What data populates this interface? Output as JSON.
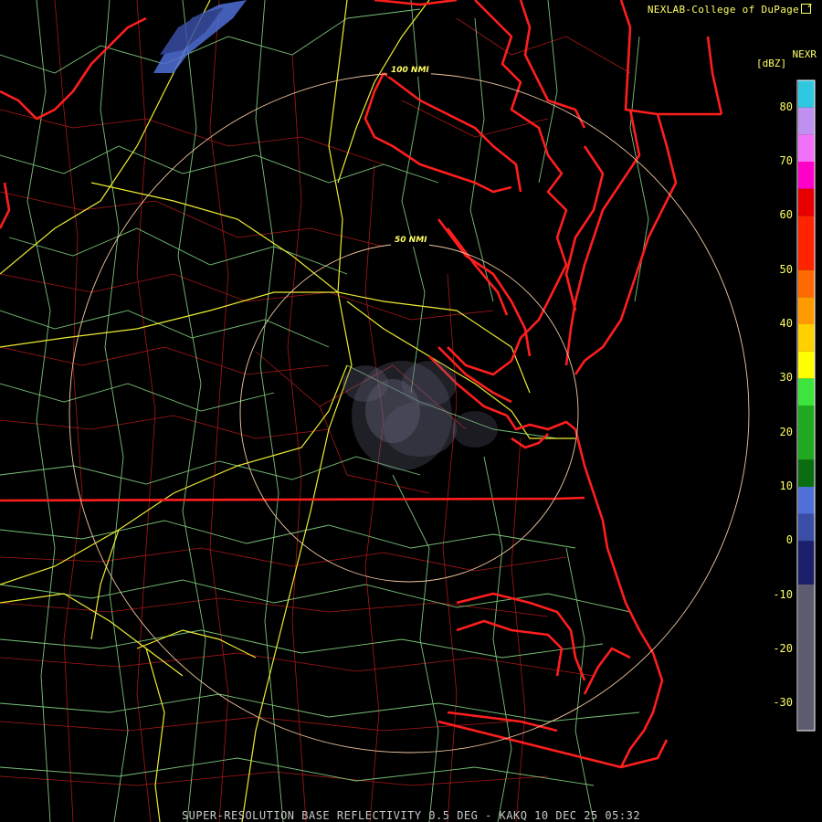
{
  "credit": "NEXLAB-College of DuPage",
  "credit_icon": "external-link-icon",
  "legend": {
    "title": "NEXR",
    "unit": "[dBZ]",
    "ticks": [
      "80",
      "70",
      "60",
      "50",
      "40",
      "30",
      "20",
      "10",
      "0",
      "-10",
      "-20",
      "-30"
    ],
    "tick_values": [
      80,
      70,
      60,
      50,
      40,
      30,
      20,
      10,
      0,
      -10,
      -20,
      -30
    ],
    "range": [
      -35,
      85
    ],
    "bands": [
      {
        "from": -35,
        "to": -8,
        "color": "#5c5c6e"
      },
      {
        "from": -8,
        "to": 0,
        "color": "#1c1f6a"
      },
      {
        "from": 0,
        "to": 5,
        "color": "#3a4ea6"
      },
      {
        "from": 5,
        "to": 10,
        "color": "#5070d8"
      },
      {
        "from": 10,
        "to": 15,
        "color": "#0a6e10"
      },
      {
        "from": 15,
        "to": 25,
        "color": "#20a820"
      },
      {
        "from": 25,
        "to": 30,
        "color": "#3ee43e"
      },
      {
        "from": 30,
        "to": 35,
        "color": "#ffff00"
      },
      {
        "from": 35,
        "to": 40,
        "color": "#ffd000"
      },
      {
        "from": 40,
        "to": 45,
        "color": "#ff9a00"
      },
      {
        "from": 45,
        "to": 50,
        "color": "#ff6a00"
      },
      {
        "from": 50,
        "to": 60,
        "color": "#ff2400"
      },
      {
        "from": 60,
        "to": 65,
        "color": "#e80000"
      },
      {
        "from": 65,
        "to": 70,
        "color": "#ff00c8"
      },
      {
        "from": 70,
        "to": 75,
        "color": "#f070f8"
      },
      {
        "from": 75,
        "to": 80,
        "color": "#c090f0"
      },
      {
        "from": 80,
        "to": 85,
        "color": "#30c8e0"
      }
    ]
  },
  "range_rings": [
    "100 NMI",
    "50 NMI"
  ],
  "footer": "SUPER-RESOLUTION BASE REFLECTIVITY 0.5 DEG - KAKQ 10 DEC 25 05:32",
  "colors": {
    "state_border": "#ff2020",
    "county_lines": "#b01818",
    "highways": "#eeee33",
    "roads": "#90e890",
    "range_ring": "#f0c8a0",
    "echo_gray": "#707080",
    "echo_blue": "#5070d8",
    "label_text": "#ffff66"
  }
}
